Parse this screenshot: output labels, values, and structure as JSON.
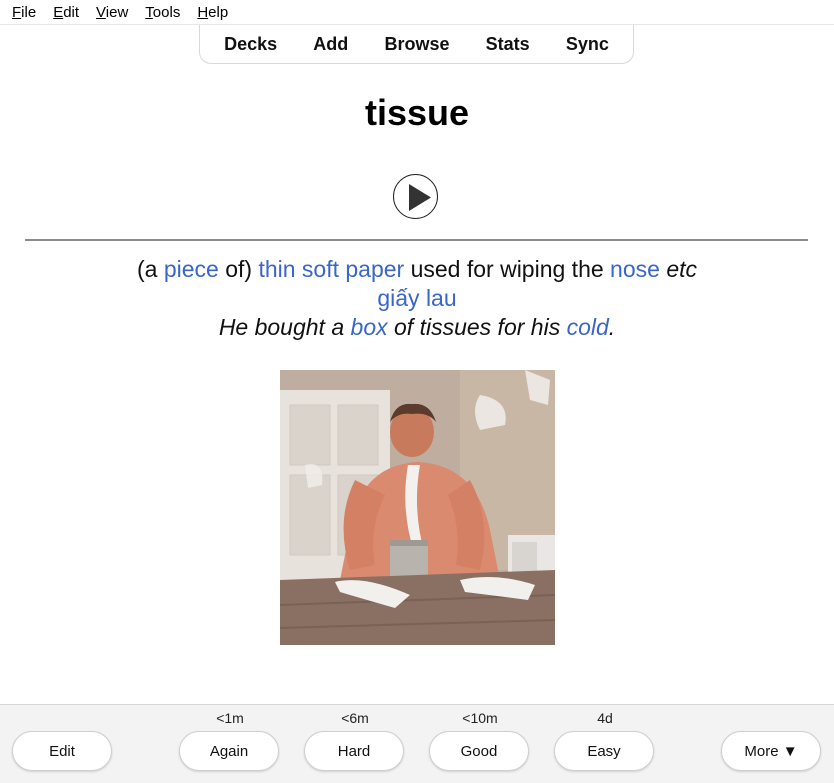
{
  "menu": [
    {
      "first": "F",
      "rest": "ile"
    },
    {
      "first": "E",
      "rest": "dit"
    },
    {
      "first": "V",
      "rest": "iew"
    },
    {
      "first": "T",
      "rest": "ools"
    },
    {
      "first": "H",
      "rest": "elp"
    }
  ],
  "toolbar": {
    "decks": "Decks",
    "add": "Add",
    "browse": "Browse",
    "stats": "Stats",
    "sync": "Sync"
  },
  "card": {
    "word": "tissue",
    "definition": {
      "p1": "(a ",
      "l1": "piece",
      "p2": " of) ",
      "l2": "thin soft paper",
      "p3": " used for wiping the ",
      "l3": "nose",
      "p4": " ",
      "i1": "etc"
    },
    "translation": "giấy lau",
    "example": {
      "p1": "He bought a ",
      "l1": "box",
      "p2": " of tissues for his ",
      "l2": "cold",
      "p3": "."
    }
  },
  "intervals": {
    "again": "<1m",
    "hard": "<6m",
    "good": "<10m",
    "easy": "4d"
  },
  "buttons": {
    "edit": "Edit",
    "again": "Again",
    "hard": "Hard",
    "good": "Good",
    "easy": "Easy",
    "more": "More ▼"
  },
  "colors": {
    "link": "#3a66c9",
    "bottombar": "#f3f3f3"
  }
}
